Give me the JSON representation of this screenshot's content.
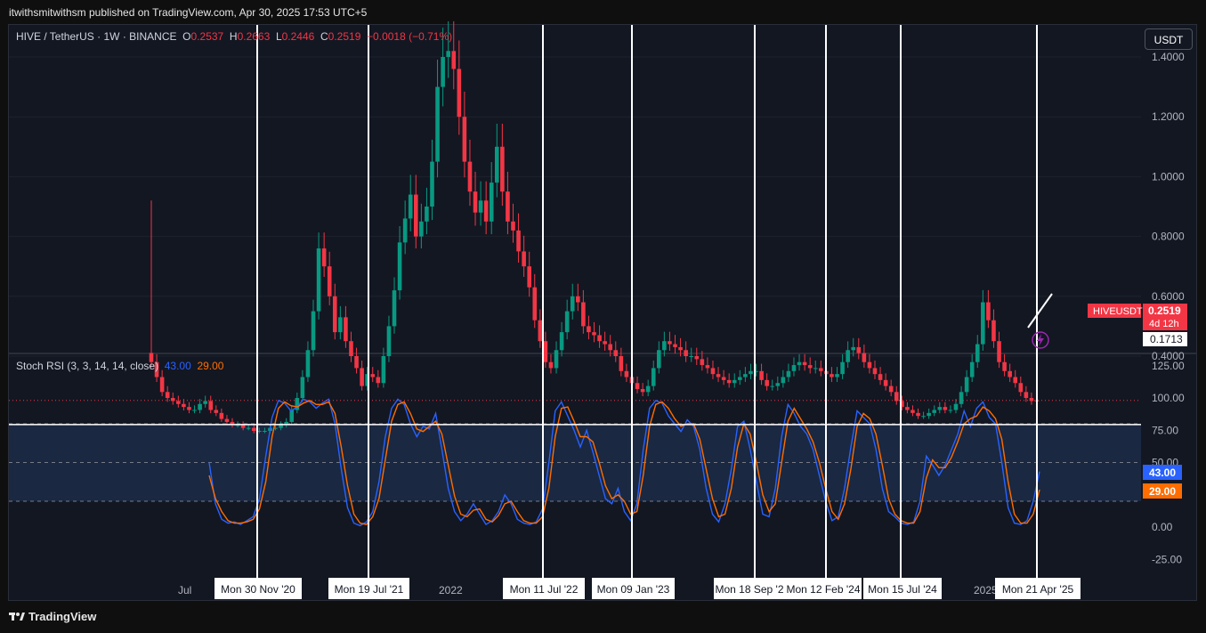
{
  "header": {
    "published": "itwithsmitwithsm published on TradingView.com, Apr 30, 2025 17:53 UTC+5"
  },
  "legend": {
    "symbol": "HIVE / TetherUS · 1W · BINANCE",
    "o_label": "O",
    "o_value": "0.2537",
    "h_label": "H",
    "h_value": "0.2663",
    "l_label": "L",
    "l_value": "0.2446",
    "c_label": "C",
    "c_value": "0.2519",
    "change": "−0.0018 (−0.71%)"
  },
  "currency_button": "USDT",
  "rsi_legend": {
    "label": "Stoch RSI (3, 3, 14, 14, close)",
    "k_value": "43.00",
    "d_value": "29.00"
  },
  "footer": {
    "brand": "TradingView"
  },
  "colors": {
    "up": "#089981",
    "down": "#f23645",
    "k_line": "#2962ff",
    "d_line": "#ff6d00",
    "band": "#1c2c46"
  },
  "chart_data": [
    {
      "type": "candlestick",
      "title": "HIVE / TetherUS · 1W · BINANCE",
      "y_ticks": [
        "1.4000",
        "1.2000",
        "1.0000",
        "0.8000",
        "0.6000",
        "0.4000"
      ],
      "ylim": [
        0.14,
        1.42
      ],
      "price_label": {
        "name": "HIVEUSDT",
        "value": "0.2519",
        "countdown": "4d 12h"
      },
      "horizontal_line_label": "0.1713",
      "horizontal_line_value": 0.1713,
      "close_series": [
        0.38,
        0.33,
        0.28,
        0.26,
        0.25,
        0.24,
        0.23,
        0.22,
        0.22,
        0.24,
        0.25,
        0.22,
        0.21,
        0.19,
        0.18,
        0.17,
        0.17,
        0.16,
        0.16,
        0.15,
        0.15,
        0.15,
        0.16,
        0.16,
        0.17,
        0.18,
        0.22,
        0.26,
        0.33,
        0.42,
        0.55,
        0.76,
        0.7,
        0.6,
        0.48,
        0.53,
        0.45,
        0.4,
        0.36,
        0.3,
        0.34,
        0.33,
        0.31,
        0.4,
        0.5,
        0.62,
        0.78,
        0.86,
        0.94,
        0.8,
        0.85,
        0.9,
        1.05,
        1.3,
        1.4,
        1.42,
        1.36,
        1.2,
        1.05,
        0.95,
        0.88,
        0.92,
        0.85,
        0.98,
        1.1,
        0.95,
        0.85,
        0.82,
        0.75,
        0.7,
        0.63,
        0.52,
        0.45,
        0.38,
        0.36,
        0.42,
        0.48,
        0.55,
        0.6,
        0.58,
        0.5,
        0.48,
        0.47,
        0.45,
        0.44,
        0.42,
        0.4,
        0.35,
        0.33,
        0.31,
        0.29,
        0.28,
        0.3,
        0.36,
        0.42,
        0.45,
        0.44,
        0.43,
        0.42,
        0.4,
        0.4,
        0.39,
        0.37,
        0.36,
        0.34,
        0.33,
        0.32,
        0.31,
        0.32,
        0.33,
        0.34,
        0.35,
        0.35,
        0.32,
        0.3,
        0.3,
        0.31,
        0.33,
        0.35,
        0.37,
        0.38,
        0.37,
        0.36,
        0.36,
        0.35,
        0.34,
        0.33,
        0.34,
        0.38,
        0.42,
        0.43,
        0.41,
        0.38,
        0.36,
        0.34,
        0.32,
        0.3,
        0.28,
        0.25,
        0.23,
        0.22,
        0.21,
        0.2,
        0.2,
        0.21,
        0.22,
        0.23,
        0.22,
        0.22,
        0.24,
        0.28,
        0.33,
        0.38,
        0.44,
        0.58,
        0.52,
        0.45,
        0.38,
        0.35,
        0.33,
        0.31,
        0.28,
        0.26,
        0.25,
        0.2519
      ],
      "x_labels": [
        "Jul",
        "2022",
        "2025"
      ],
      "vertical_markers": [
        "Mon 30 Nov '20",
        "Mon 19 Jul '21",
        "Mon 11 Jul '22",
        "Mon 09 Jan '23",
        "Mon 18 Sep '2",
        "Mon 12 Feb '24",
        "Mon 15 Jul '24",
        "Mon 21 Apr '25"
      ]
    },
    {
      "type": "line",
      "title": "Stoch RSI (3, 3, 14, 14, close)",
      "y_ticks": [
        "125.00",
        "100.00",
        "75.00",
        "50.00",
        "25.00",
        "0.00",
        "-25.00"
      ],
      "ylim": [
        -30,
        128
      ],
      "bands": [
        20,
        50,
        80
      ],
      "series": [
        {
          "name": "K",
          "last": "43.00",
          "values": [
            50,
            18,
            6,
            3,
            4,
            2,
            5,
            8,
            22,
            55,
            85,
            98,
            96,
            90,
            93,
            99,
            97,
            92,
            96,
            99,
            80,
            45,
            15,
            3,
            1,
            4,
            12,
            35,
            70,
            92,
            99,
            95,
            80,
            70,
            78,
            76,
            88,
            60,
            30,
            12,
            5,
            10,
            18,
            10,
            2,
            5,
            12,
            25,
            18,
            6,
            3,
            2,
            4,
            14,
            50,
            90,
            97,
            86,
            75,
            62,
            75,
            58,
            40,
            22,
            18,
            30,
            12,
            5,
            18,
            60,
            92,
            98,
            96,
            86,
            80,
            74,
            83,
            78,
            60,
            30,
            10,
            4,
            18,
            45,
            78,
            82,
            60,
            35,
            10,
            8,
            30,
            70,
            95,
            88,
            78,
            72,
            60,
            40,
            20,
            5,
            8,
            30,
            62,
            90,
            85,
            80,
            60,
            30,
            12,
            8,
            3,
            2,
            4,
            20,
            55,
            48,
            40,
            48,
            60,
            72,
            90,
            78,
            92,
            97,
            85,
            80,
            50,
            15,
            3,
            2,
            5,
            20,
            43
          ]
        },
        {
          "name": "D",
          "last": "29.00",
          "values": [
            40,
            22,
            12,
            5,
            3,
            3,
            4,
            6,
            14,
            35,
            70,
            92,
            97,
            94,
            93,
            96,
            98,
            95,
            95,
            97,
            88,
            62,
            32,
            10,
            3,
            2,
            8,
            22,
            52,
            82,
            95,
            97,
            88,
            76,
            74,
            78,
            82,
            72,
            48,
            24,
            10,
            8,
            13,
            14,
            6,
            4,
            9,
            18,
            20,
            12,
            5,
            3,
            3,
            8,
            30,
            70,
            92,
            93,
            82,
            70,
            70,
            66,
            50,
            32,
            22,
            25,
            20,
            10,
            12,
            40,
            78,
            95,
            97,
            92,
            84,
            78,
            80,
            80,
            68,
            45,
            22,
            8,
            10,
            30,
            62,
            80,
            72,
            50,
            25,
            12,
            18,
            50,
            82,
            92,
            84,
            76,
            66,
            50,
            30,
            12,
            6,
            18,
            45,
            78,
            88,
            84,
            72,
            48,
            22,
            10,
            5,
            3,
            3,
            12,
            38,
            52,
            46,
            46,
            54,
            66,
            80,
            84,
            86,
            93,
            90,
            84,
            68,
            35,
            10,
            3,
            3,
            10,
            29
          ]
        }
      ]
    }
  ]
}
